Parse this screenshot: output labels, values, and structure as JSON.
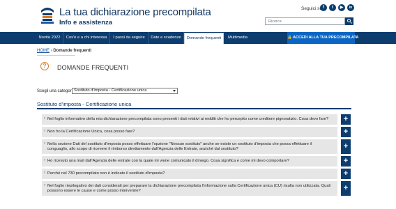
{
  "header": {
    "title": "La tua dichiarazione precompilata",
    "subtitle": "Info e assistenza",
    "social_label": "Seguici su",
    "social": [
      {
        "icon": "facebook-icon",
        "glyph": "f"
      },
      {
        "icon": "twitter-icon",
        "glyph": "t"
      },
      {
        "icon": "youtube-icon",
        "glyph": "▶"
      },
      {
        "icon": "linkedin-icon",
        "glyph": "in"
      }
    ],
    "search_placeholder": "Ricerca"
  },
  "nav": {
    "items": [
      "Novità 2022",
      "Cos'è e a chi interessa",
      "I passi da seguire",
      "Date e scadenze",
      "Domande frequenti",
      "Multimedia"
    ],
    "active": "Domande frequenti",
    "cta": "🔒 ACCEDI ALLA TUA PRECOMPILATA"
  },
  "breadcrumb": {
    "home": "HOME",
    "separator": " › ",
    "current": "Domande frequenti"
  },
  "page": {
    "title": "DOMANDE FREQUENTI"
  },
  "category": {
    "label": "Scegli una categoria",
    "selected": "Sostituto d'imposta - Certificazione unica"
  },
  "section": {
    "title": "Sostituto d'imposta - Certificazione unica"
  },
  "faqs": [
    "Nel foglio informativo della mia dichiarazione precompilata sono presenti i dati relativi ai redditi che ho percepito come creditore pignoratizio. Cosa devo fare?",
    "Non ho la Certificazione Unica, cosa posso fare?",
    "Nella sezione Dati del sostituto d'imposta posso effettuare l'opzione \"Nessun sostituto\" anche se esiste un sostituto d'imposta che possa effettuare il conguaglio, allo scopo di ricevere il rimborso direttamente dall'Agenzia delle Entrate, anziché dal sostituto?",
    "Ho ricevuto una mail dall'Agenzia delle entrate con la quale mi viene comunicato il diniego. Cosa significa e come mi devo comportare?",
    "Perché nel 730 precompilato non è indicato il sostituto d'imposta?",
    "Nel foglio riepilogativo dei dati considerati per preparare la dichiarazione precompilata l'informazione sulla Certificazione unica (CU) risulta non utilizzata. Quali possono essere le cause e come posso intervenire?"
  ],
  "colors": {
    "brand": "#0d3c6e",
    "cta": "#0a66c2",
    "accent": "#e07b1a",
    "faq_bg": "#e6e6e6"
  }
}
